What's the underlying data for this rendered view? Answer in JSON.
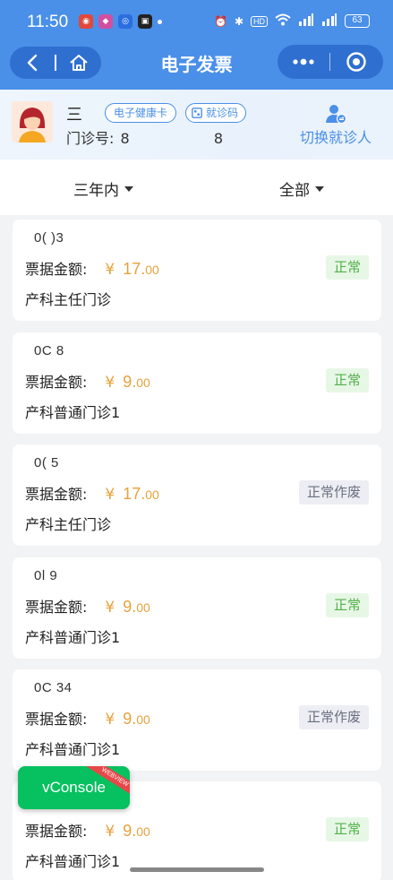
{
  "status_bar": {
    "time": "11:50",
    "hd": "HD",
    "battery": "63"
  },
  "nav": {
    "title": "电子发票"
  },
  "patient": {
    "name": "三",
    "health_card": "电子健康卡",
    "visit_code": "就诊码",
    "clinic_label": "门诊号:",
    "clinic_no_start": "8",
    "clinic_no_end": "8",
    "switch_label": "切换就诊人"
  },
  "filters": {
    "period": "三年内",
    "status": "全部"
  },
  "labels": {
    "amount": "票据金额:",
    "currency": "¥"
  },
  "invoices": [
    {
      "no": "0(          )3",
      "amount_int": "17.",
      "amount_dec": "00",
      "dept": "产科主任门诊",
      "status": "正常",
      "status_type": "normal"
    },
    {
      "no": "0C           8",
      "amount_int": "9.",
      "amount_dec": "00",
      "dept": "产科普通门诊1",
      "status": "正常",
      "status_type": "normal"
    },
    {
      "no": "0(           5",
      "amount_int": "17.",
      "amount_dec": "00",
      "dept": "产科主任门诊",
      "status": "正常作废",
      "status_type": "void"
    },
    {
      "no": "0l           9",
      "amount_int": "9.",
      "amount_dec": "00",
      "dept": "产科普通门诊1",
      "status": "正常",
      "status_type": "normal"
    },
    {
      "no": "0C          34",
      "amount_int": "9.",
      "amount_dec": "00",
      "dept": "产科普通门诊1",
      "status": "正常作废",
      "status_type": "void"
    },
    {
      "no": "",
      "amount_int": "9.",
      "amount_dec": "00",
      "dept": "产科普通门诊1",
      "status": "正常",
      "status_type": "normal"
    }
  ],
  "vconsole": {
    "label": "vConsole",
    "ribbon": "WEBVIEW"
  },
  "colors": {
    "brand_blue": "#4a8fe8",
    "amount_orange": "#e6a23c",
    "normal_green": "#52b04a",
    "vconsole_green": "#07c160"
  }
}
